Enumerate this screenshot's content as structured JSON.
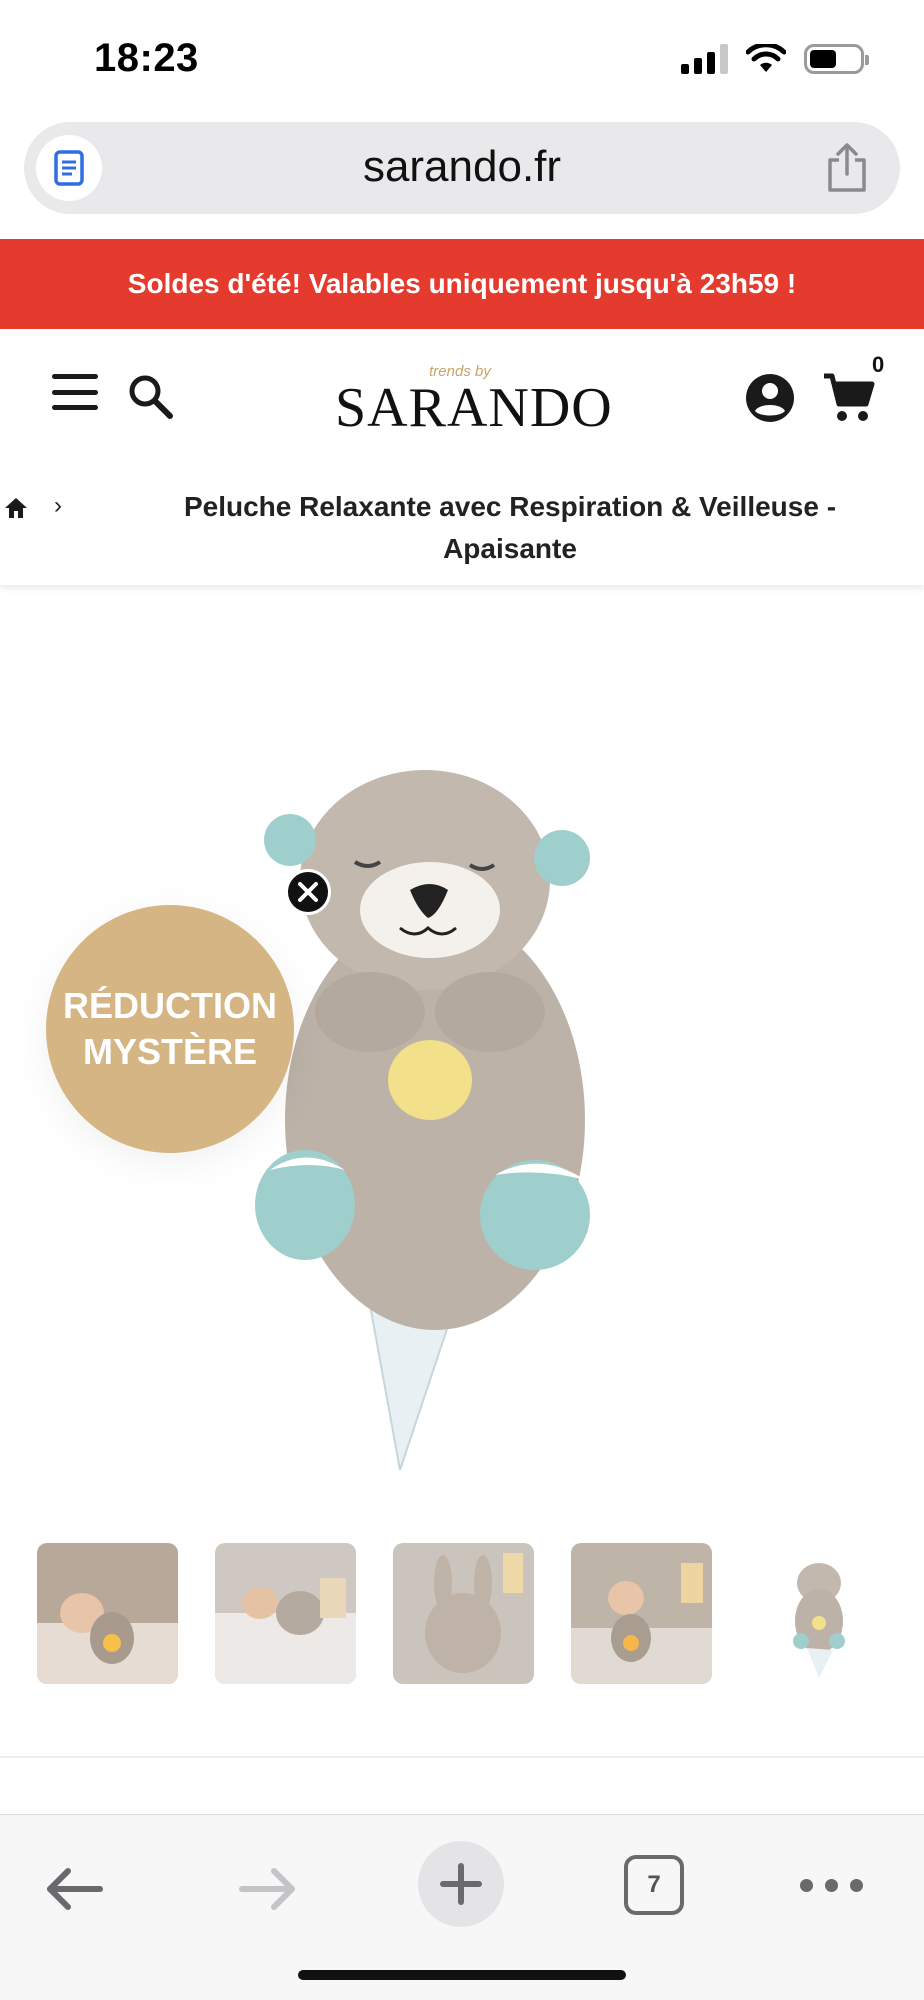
{
  "status_bar": {
    "time": "18:23"
  },
  "browser": {
    "url": "sarando.fr",
    "open_tabs_count": "7"
  },
  "promo_banner": {
    "text": "Soldes d'été! Valables uniquement jusqu'à 23h59 !"
  },
  "header": {
    "logo_tagline": "trends by",
    "logo_name": "SARANDO",
    "cart_count": "0"
  },
  "breadcrumb": {
    "separator": "›",
    "current": "Peluche Relaxante avec Respiration & Veilleuse - Apaisante"
  },
  "product": {
    "badge_line1": "RÉDUCTION",
    "badge_line2": "MYSTÈRE",
    "thumbnails": [
      "thumbnail-1",
      "thumbnail-2",
      "thumbnail-3",
      "thumbnail-4",
      "thumbnail-5"
    ]
  },
  "colors": {
    "promo_red": "#e53a2e",
    "badge_gold": "#d4b583",
    "logo_accent": "#c8a465"
  },
  "icons": [
    "reader-icon",
    "share-icon",
    "menu-icon",
    "search-icon",
    "account-icon",
    "cart-icon",
    "home-icon",
    "close-icon",
    "back-arrow-icon",
    "forward-arrow-icon",
    "plus-icon",
    "tabs-icon",
    "more-icon"
  ]
}
